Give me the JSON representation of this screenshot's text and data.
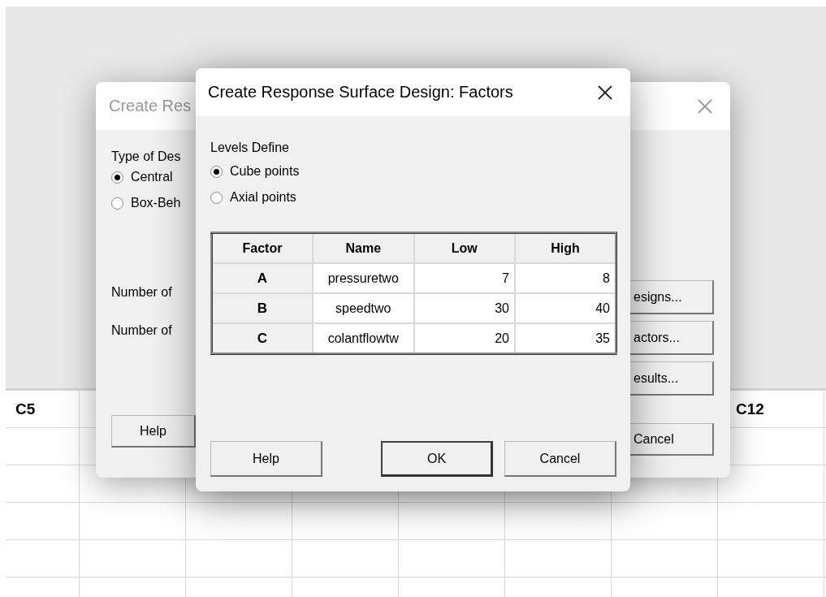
{
  "worksheet": {
    "column_headers": [
      "C5",
      "C12"
    ]
  },
  "background_dialog": {
    "title": "Create Res",
    "type_label": "Type of Des",
    "design_types": [
      {
        "label": "Central",
        "selected": true
      },
      {
        "label": "Box-Beh",
        "selected": false
      }
    ],
    "number_labels": [
      "Number of",
      "Number of"
    ],
    "side_buttons": [
      "esigns...",
      "actors...",
      "esults..."
    ],
    "help_button": "Help",
    "cancel_button": "Cancel"
  },
  "factors_dialog": {
    "title": "Create Response Surface Design: Factors",
    "levels_label": "Levels Define",
    "levels": [
      {
        "label": "Cube points",
        "selected": true
      },
      {
        "label": "Axial points",
        "selected": false
      }
    ],
    "table": {
      "columns": [
        "Factor",
        "Name",
        "Low",
        "High"
      ],
      "rows": [
        [
          "A",
          "pressuretwo",
          "7",
          "8"
        ],
        [
          "B",
          "speedtwo",
          "30",
          "40"
        ],
        [
          "C",
          "colantflowtw",
          "20",
          "35"
        ]
      ]
    },
    "buttons": [
      {
        "label": "Help",
        "default": false
      },
      {
        "label": "OK",
        "default": true
      },
      {
        "label": "Cancel",
        "default": false
      }
    ]
  }
}
